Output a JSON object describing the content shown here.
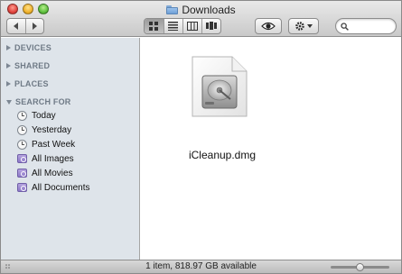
{
  "window": {
    "title": "Downloads",
    "title_icon": "folder-icon"
  },
  "toolbar": {
    "back_icon": "chevron-left-icon",
    "forward_icon": "chevron-right-icon",
    "views": [
      "icon-view",
      "list-view",
      "column-view",
      "cover-flow-view"
    ],
    "active_view": "icon-view",
    "quicklook_icon": "eye-icon",
    "action_icon": "gear-icon",
    "search": {
      "value": "",
      "placeholder": ""
    }
  },
  "sidebar": {
    "sections": [
      {
        "label": "DEVICES",
        "expanded": false
      },
      {
        "label": "SHARED",
        "expanded": false
      },
      {
        "label": "PLACES",
        "expanded": false
      },
      {
        "label": "SEARCH FOR",
        "expanded": true
      }
    ],
    "search_items": [
      {
        "label": "Today",
        "icon": "clock-icon"
      },
      {
        "label": "Yesterday",
        "icon": "clock-icon"
      },
      {
        "label": "Past Week",
        "icon": "clock-icon"
      },
      {
        "label": "All Images",
        "icon": "smart-folder-icon"
      },
      {
        "label": "All Movies",
        "icon": "smart-folder-icon"
      },
      {
        "label": "All Documents",
        "icon": "smart-folder-icon"
      }
    ]
  },
  "content": {
    "files": [
      {
        "name": "iCleanup.dmg",
        "icon": "disk-image-icon"
      }
    ]
  },
  "status": {
    "text": "1 item, 818.97 GB available",
    "icon_size_fraction": 0.5
  },
  "colors": {
    "sidebar_bg": "#dee4ea",
    "section_header": "#6f7a86",
    "close": "#e0443e",
    "minimize": "#f0b32e",
    "maximize": "#5fc13f"
  }
}
